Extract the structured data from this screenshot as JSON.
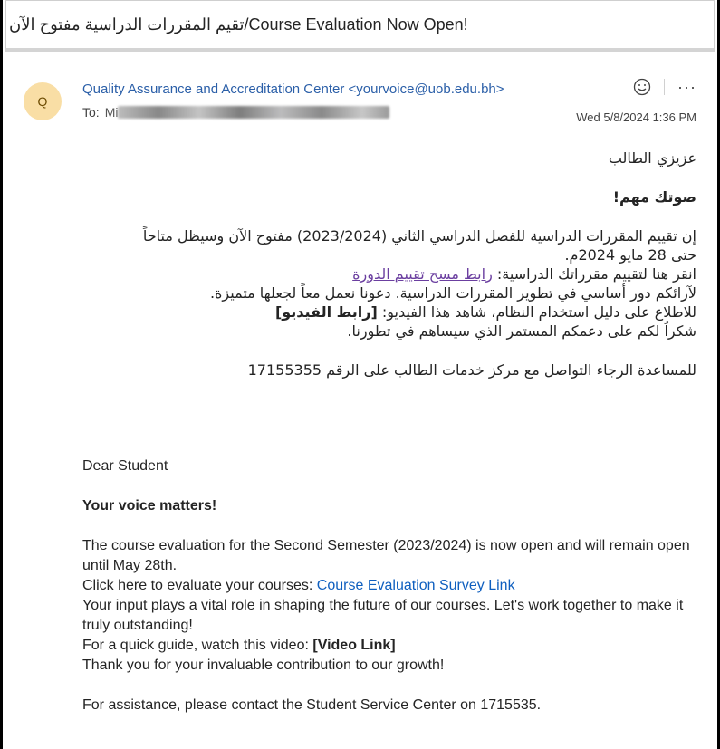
{
  "subject": "تقيم المقررات الدراسية مفتوح الآن/Course Evaluation Now Open!",
  "header": {
    "avatar_initial": "Q",
    "sender": "Quality Assurance and Accreditation Center <yourvoice@uob.edu.bh>",
    "to_label": "To:",
    "to_visible_prefix": "Mi",
    "date": "Wed 5/8/2024 1:36 PM",
    "more_label": "···"
  },
  "arabic": {
    "greeting": "عزيزي الطالب",
    "heading": "صوتك مهم!",
    "p1_line1": "إن تقييم المقررات الدراسية للفصل الدراسي الثاني (2023/2024) مفتوح الآن وسيظل متاحاً",
    "p1_line2": "حتى 28 مايو 2024م.",
    "click_prefix": "انقر هنا لتقييم مقرراتك الدراسية: ",
    "survey_link": "رابط مسح تقييم الدورة ",
    "role_line": "لآرائكم دور أساسي في تطوير المقررات الدراسية. دعونا نعمل معاً لجعلها متميزة.",
    "guide_prefix": "للاطلاع على دليل استخدام النظام، شاهد هذا الفيديو: ",
    "video_link": "[رابط الفيديو]",
    "thanks": "شكراً لكم على دعمكم المستمر الذي سيساهم في تطورنا.",
    "assistance": "للمساعدة الرجاء التواصل مع مركز خدمات الطالب على الرقم 17155355"
  },
  "english": {
    "greeting": "Dear Student",
    "heading": "Your voice matters!",
    "p1": "The course evaluation for the Second Semester (2023/2024) is now open and will remain open until May 28th.",
    "click_prefix": "Click here to evaluate your courses: ",
    "survey_link": "Course Evaluation Survey Link",
    "input_line": "Your input plays a vital role in shaping the future of our courses. Let's work together to make it truly outstanding!",
    "guide_prefix": "For a quick guide, watch this video: ",
    "video_link": "[Video Link]",
    "thanks": "Thank you for your invaluable contribution to our growth!",
    "assistance": "For assistance, please contact the Student Service Center on 1715535."
  }
}
